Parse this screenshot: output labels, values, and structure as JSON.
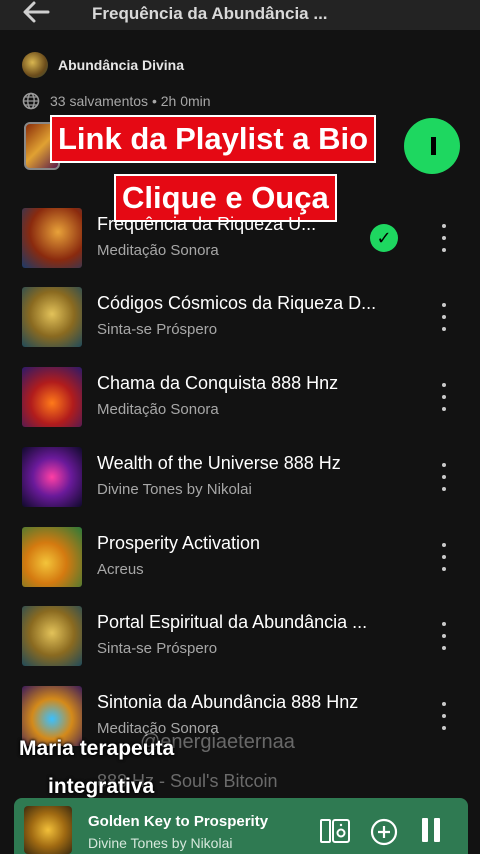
{
  "header": {
    "back_icon": "arrow-left-icon",
    "title": "Frequência da Abundância ..."
  },
  "playlist": {
    "owner": "Abundância Divina",
    "meta": "33 salvamentos • 2h 0min",
    "play_color": "#1ed760"
  },
  "overlay": {
    "banner_1": "Link da Playlist a Bio",
    "banner_2": "Clique e Ouça",
    "caption_line_1": "Maria terapeuta",
    "caption_line_2": "integrativa",
    "watermark": "@energiaeternaa"
  },
  "tracks": [
    {
      "title": "Frequência da Riqueza U...",
      "artist": "Meditação Sonora",
      "saved": true
    },
    {
      "title": "Códigos Cósmicos da Riqueza D...",
      "artist": "Sinta-se Próspero",
      "saved": false
    },
    {
      "title": "Chama da Conquista 888 Hnz",
      "artist": "Meditação Sonora",
      "saved": false
    },
    {
      "title": "Wealth of the Universe 888 Hz",
      "artist": "Divine Tones by Nikolai",
      "saved": false
    },
    {
      "title": "Prosperity Activation",
      "artist": "Acreus",
      "saved": false
    },
    {
      "title": "Portal Espiritual da Abundância ...",
      "artist": "Sinta-se Próspero",
      "saved": false
    },
    {
      "title": "Sintonia da Abundância 888 Hnz",
      "artist": "Meditação Sonora",
      "saved": false
    },
    {
      "title": "888 Hz - Soul's Bitcoin",
      "artist": "",
      "saved": false
    }
  ],
  "now_playing": {
    "title": "Golden Key to Prosperity",
    "artist": "Divine Tones by Nikolai",
    "background": "#2f7a52"
  }
}
